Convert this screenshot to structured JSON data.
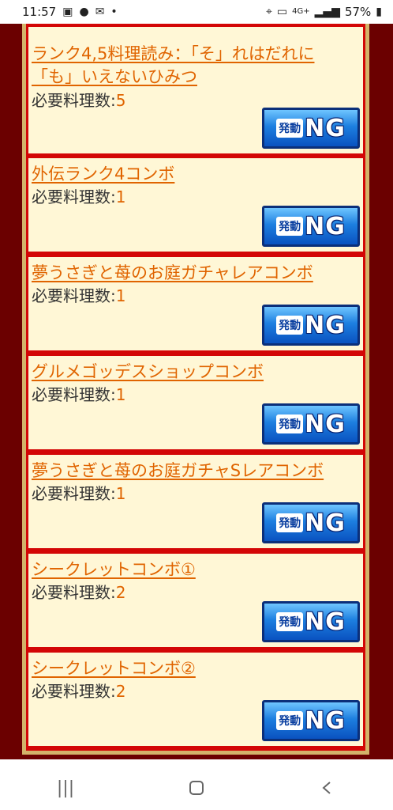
{
  "status_bar": {
    "time": "11:57",
    "battery": "57%",
    "network": "4G+"
  },
  "cards": [
    {
      "title": "ランク4,5料理読み：「そ」れはだれに「も」いえないひみつ",
      "req_label": "必要料理数:",
      "req_value": "5",
      "button": {
        "jp": "発動",
        "ng": "NG"
      }
    },
    {
      "title": "外伝ランク4コンボ",
      "req_label": "必要料理数:",
      "req_value": "1",
      "button": {
        "jp": "発動",
        "ng": "NG"
      }
    },
    {
      "title": "夢うさぎと苺のお庭ガチャレアコンボ",
      "req_label": "必要料理数:",
      "req_value": "1",
      "button": {
        "jp": "発動",
        "ng": "NG"
      }
    },
    {
      "title": "グルメゴッデスショップコンボ",
      "req_label": "必要料理数:",
      "req_value": "1",
      "button": {
        "jp": "発動",
        "ng": "NG"
      }
    },
    {
      "title": "夢うさぎと苺のお庭ガチャSレアコンボ",
      "req_label": "必要料理数:",
      "req_value": "1",
      "button": {
        "jp": "発動",
        "ng": "NG"
      }
    },
    {
      "title": "シークレットコンボ①",
      "req_label": "必要料理数:",
      "req_value": "2",
      "button": {
        "jp": "発動",
        "ng": "NG"
      }
    },
    {
      "title": "シークレットコンボ②",
      "req_label": "必要料理数:",
      "req_value": "2",
      "button": {
        "jp": "発動",
        "ng": "NG"
      }
    }
  ],
  "nav": {
    "recents": "recents-icon",
    "home": "home-icon",
    "back": "back-icon"
  }
}
